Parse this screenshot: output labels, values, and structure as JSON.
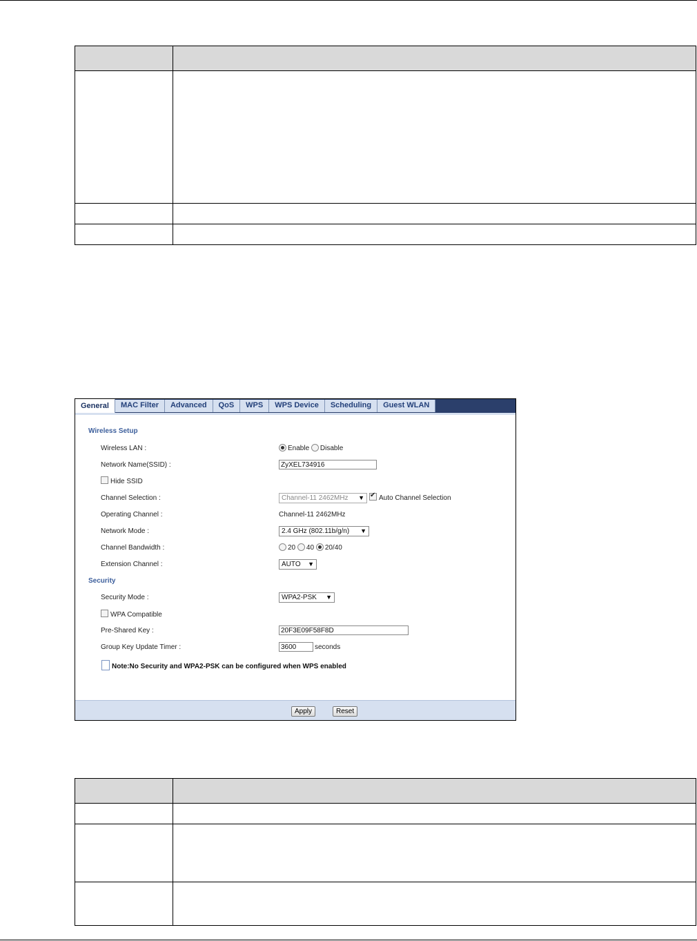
{
  "panel": {
    "tabs": [
      {
        "label": "General",
        "active": true
      },
      {
        "label": "MAC Filter",
        "active": false
      },
      {
        "label": "Advanced",
        "active": false
      },
      {
        "label": "QoS",
        "active": false
      },
      {
        "label": "WPS",
        "active": false
      },
      {
        "label": "WPS Device",
        "active": false
      },
      {
        "label": "Scheduling",
        "active": false
      },
      {
        "label": "Guest WLAN",
        "active": false
      }
    ],
    "wireless_setup": {
      "heading": "Wireless Setup",
      "wireless_lan_label": "Wireless LAN :",
      "enable_label": "Enable",
      "disable_label": "Disable",
      "ssid_label": "Network Name(SSID) :",
      "ssid_value": "ZyXEL734916",
      "hide_ssid_label": "Hide SSID",
      "channel_selection_label": "Channel Selection :",
      "channel_selection_value": "Channel-11 2462MHz",
      "auto_channel_label": "Auto Channel Selection",
      "operating_channel_label": "Operating Channel :",
      "operating_channel_value": "Channel-11 2462MHz",
      "network_mode_label": "Network Mode :",
      "network_mode_value": "2.4 GHz (802.11b/g/n)",
      "bandwidth_label": "Channel Bandwidth :",
      "bw_20": "20",
      "bw_40": "40",
      "bw_2040": "20/40",
      "extension_label": "Extension Channel :",
      "extension_value": "AUTO"
    },
    "security": {
      "heading": "Security",
      "mode_label": "Security Mode :",
      "mode_value": "WPA2-PSK",
      "wpa_compatible_label": "WPA Compatible",
      "psk_label": "Pre-Shared Key :",
      "psk_value": "20F3E09F58F8D",
      "timer_label": "Group Key Update Timer :",
      "timer_value": "3600",
      "timer_unit": "seconds"
    },
    "note": "Note:No Security and WPA2-PSK can be configured when WPS enabled",
    "apply_label": "Apply",
    "reset_label": "Reset",
    "arrow": "▼",
    "colors": {
      "tab_bar": "#2b3f6b",
      "section_heading": "#3d5f9c",
      "footer": "#d6e0f0"
    }
  }
}
